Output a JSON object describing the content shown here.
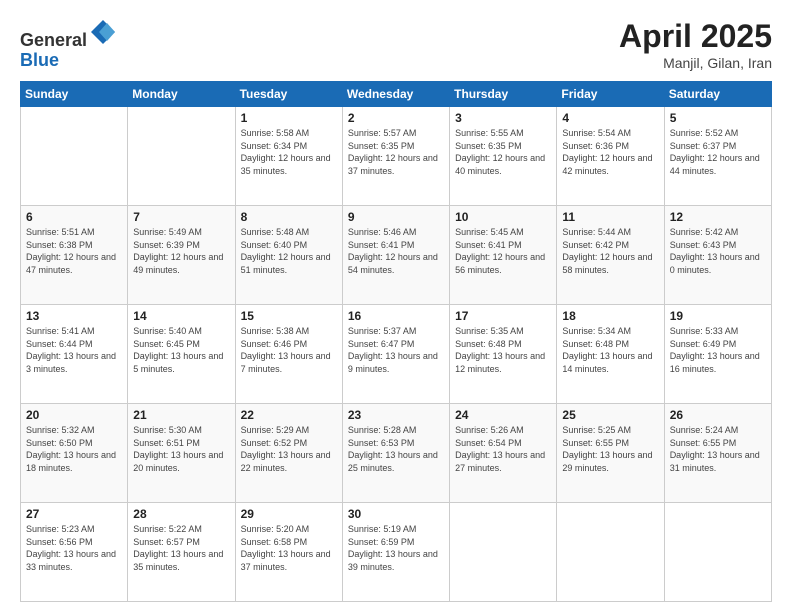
{
  "header": {
    "logo_line1": "General",
    "logo_line2": "Blue",
    "month": "April 2025",
    "location": "Manjil, Gilan, Iran"
  },
  "weekdays": [
    "Sunday",
    "Monday",
    "Tuesday",
    "Wednesday",
    "Thursday",
    "Friday",
    "Saturday"
  ],
  "weeks": [
    [
      null,
      null,
      {
        "day": 1,
        "sunrise": "5:58 AM",
        "sunset": "6:34 PM",
        "daylight": "12 hours and 35 minutes."
      },
      {
        "day": 2,
        "sunrise": "5:57 AM",
        "sunset": "6:35 PM",
        "daylight": "12 hours and 37 minutes."
      },
      {
        "day": 3,
        "sunrise": "5:55 AM",
        "sunset": "6:35 PM",
        "daylight": "12 hours and 40 minutes."
      },
      {
        "day": 4,
        "sunrise": "5:54 AM",
        "sunset": "6:36 PM",
        "daylight": "12 hours and 42 minutes."
      },
      {
        "day": 5,
        "sunrise": "5:52 AM",
        "sunset": "6:37 PM",
        "daylight": "12 hours and 44 minutes."
      }
    ],
    [
      {
        "day": 6,
        "sunrise": "5:51 AM",
        "sunset": "6:38 PM",
        "daylight": "12 hours and 47 minutes."
      },
      {
        "day": 7,
        "sunrise": "5:49 AM",
        "sunset": "6:39 PM",
        "daylight": "12 hours and 49 minutes."
      },
      {
        "day": 8,
        "sunrise": "5:48 AM",
        "sunset": "6:40 PM",
        "daylight": "12 hours and 51 minutes."
      },
      {
        "day": 9,
        "sunrise": "5:46 AM",
        "sunset": "6:41 PM",
        "daylight": "12 hours and 54 minutes."
      },
      {
        "day": 10,
        "sunrise": "5:45 AM",
        "sunset": "6:41 PM",
        "daylight": "12 hours and 56 minutes."
      },
      {
        "day": 11,
        "sunrise": "5:44 AM",
        "sunset": "6:42 PM",
        "daylight": "12 hours and 58 minutes."
      },
      {
        "day": 12,
        "sunrise": "5:42 AM",
        "sunset": "6:43 PM",
        "daylight": "13 hours and 0 minutes."
      }
    ],
    [
      {
        "day": 13,
        "sunrise": "5:41 AM",
        "sunset": "6:44 PM",
        "daylight": "13 hours and 3 minutes."
      },
      {
        "day": 14,
        "sunrise": "5:40 AM",
        "sunset": "6:45 PM",
        "daylight": "13 hours and 5 minutes."
      },
      {
        "day": 15,
        "sunrise": "5:38 AM",
        "sunset": "6:46 PM",
        "daylight": "13 hours and 7 minutes."
      },
      {
        "day": 16,
        "sunrise": "5:37 AM",
        "sunset": "6:47 PM",
        "daylight": "13 hours and 9 minutes."
      },
      {
        "day": 17,
        "sunrise": "5:35 AM",
        "sunset": "6:48 PM",
        "daylight": "13 hours and 12 minutes."
      },
      {
        "day": 18,
        "sunrise": "5:34 AM",
        "sunset": "6:48 PM",
        "daylight": "13 hours and 14 minutes."
      },
      {
        "day": 19,
        "sunrise": "5:33 AM",
        "sunset": "6:49 PM",
        "daylight": "13 hours and 16 minutes."
      }
    ],
    [
      {
        "day": 20,
        "sunrise": "5:32 AM",
        "sunset": "6:50 PM",
        "daylight": "13 hours and 18 minutes."
      },
      {
        "day": 21,
        "sunrise": "5:30 AM",
        "sunset": "6:51 PM",
        "daylight": "13 hours and 20 minutes."
      },
      {
        "day": 22,
        "sunrise": "5:29 AM",
        "sunset": "6:52 PM",
        "daylight": "13 hours and 22 minutes."
      },
      {
        "day": 23,
        "sunrise": "5:28 AM",
        "sunset": "6:53 PM",
        "daylight": "13 hours and 25 minutes."
      },
      {
        "day": 24,
        "sunrise": "5:26 AM",
        "sunset": "6:54 PM",
        "daylight": "13 hours and 27 minutes."
      },
      {
        "day": 25,
        "sunrise": "5:25 AM",
        "sunset": "6:55 PM",
        "daylight": "13 hours and 29 minutes."
      },
      {
        "day": 26,
        "sunrise": "5:24 AM",
        "sunset": "6:55 PM",
        "daylight": "13 hours and 31 minutes."
      }
    ],
    [
      {
        "day": 27,
        "sunrise": "5:23 AM",
        "sunset": "6:56 PM",
        "daylight": "13 hours and 33 minutes."
      },
      {
        "day": 28,
        "sunrise": "5:22 AM",
        "sunset": "6:57 PM",
        "daylight": "13 hours and 35 minutes."
      },
      {
        "day": 29,
        "sunrise": "5:20 AM",
        "sunset": "6:58 PM",
        "daylight": "13 hours and 37 minutes."
      },
      {
        "day": 30,
        "sunrise": "5:19 AM",
        "sunset": "6:59 PM",
        "daylight": "13 hours and 39 minutes."
      },
      null,
      null,
      null
    ]
  ]
}
